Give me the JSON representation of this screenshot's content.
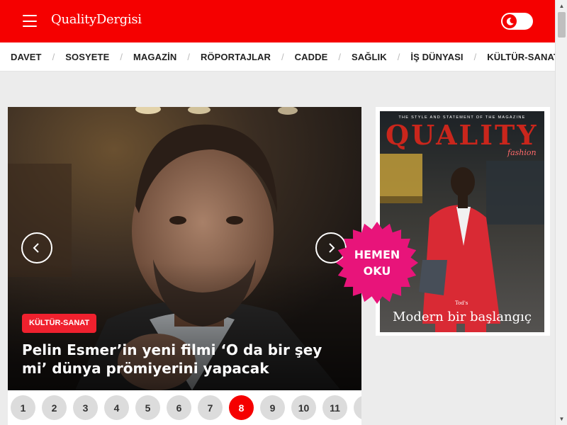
{
  "header": {
    "logo": "QualityDergisi",
    "menu_icon": "hamburger-menu-icon",
    "theme_toggle_icon": "moon-icon",
    "brand_color": "#f50000"
  },
  "nav": {
    "items": [
      "DAVET",
      "SOSYETE",
      "MAGAZİN",
      "RÖPORTAJLAR",
      "CADDE",
      "SAĞLIK",
      "İŞ DÜNYASI",
      "KÜLTÜR-SANAT"
    ]
  },
  "slider": {
    "category": "KÜLTÜR-SANAT",
    "title": "Pelin Esmer’in yeni filmi ‘O da bir şey mi’ dünya prömiyerini yapacak",
    "prev_icon": "chevron-left-icon",
    "next_icon": "chevron-right-icon",
    "pages": [
      "1",
      "2",
      "3",
      "4",
      "5",
      "6",
      "7",
      "8",
      "9",
      "10",
      "11"
    ],
    "active_page": "8",
    "badge_color": "#f0212e"
  },
  "magazine": {
    "tagline": "THE STYLE AND STATEMENT OF THE MAGAZINE",
    "title": "QUALITY",
    "subtitle": "fashion",
    "brand": "Tod's",
    "headline": "Modern bir başlangıç"
  },
  "cta": {
    "line1": "HEMEN",
    "line2": "OKU",
    "color": "#e8147a"
  }
}
